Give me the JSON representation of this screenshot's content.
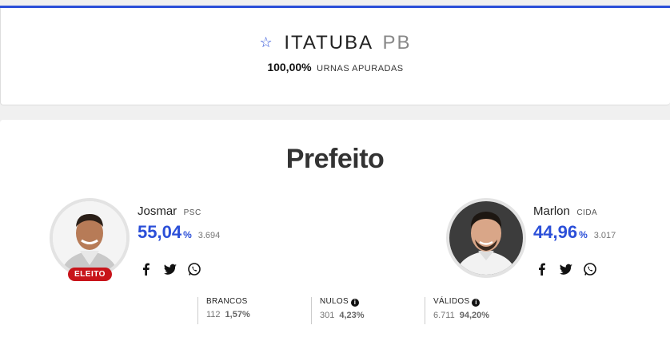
{
  "header": {
    "city": "ITATUBA",
    "state": "PB",
    "counted_pct": "100,00%",
    "counted_label": "URNAS APURADAS"
  },
  "race": {
    "office": "Prefeito"
  },
  "candidates": [
    {
      "name": "Josmar",
      "party": "PSC",
      "pct": "55,04",
      "pct_sign": "%",
      "votes": "3.694",
      "badge": "ELEITO"
    },
    {
      "name": "Marlon",
      "party": "CIDA",
      "pct": "44,96",
      "pct_sign": "%",
      "votes": "3.017"
    }
  ],
  "stats": [
    {
      "label": "BRANCOS",
      "count": "112",
      "pct": "1,57%"
    },
    {
      "label": "NULOS",
      "count": "301",
      "pct": "4,23%"
    },
    {
      "label": "VÁLIDOS",
      "count": "6.711",
      "pct": "94,20%"
    }
  ],
  "colors": {
    "accent": "#2b4fd8",
    "elected_badge": "#c8141a"
  },
  "icons": [
    "star-icon",
    "facebook-icon",
    "twitter-icon",
    "whatsapp-icon",
    "info-icon"
  ]
}
